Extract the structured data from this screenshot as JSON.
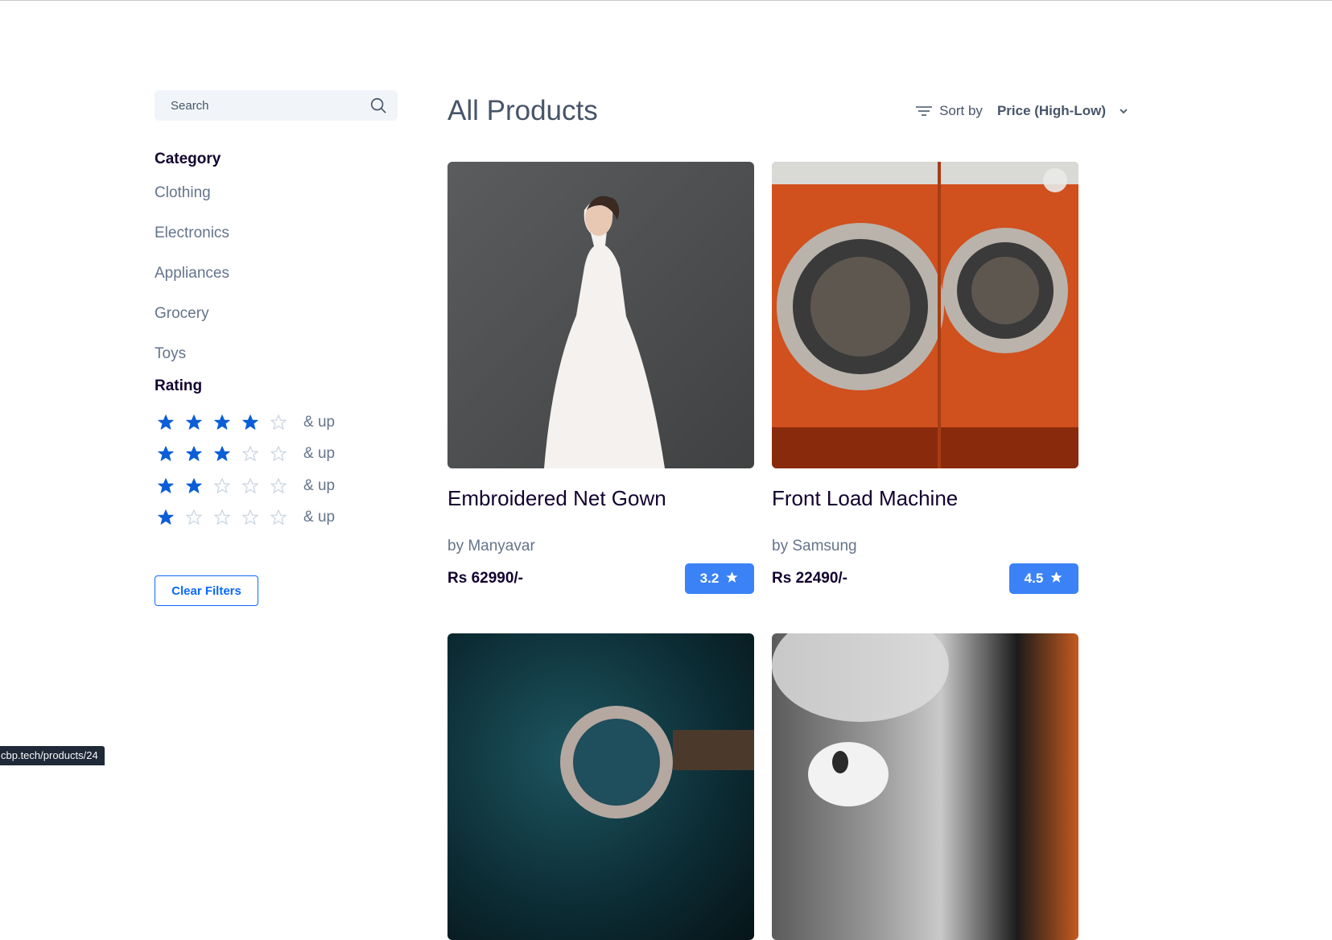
{
  "search": {
    "placeholder": "Search"
  },
  "filters": {
    "category_heading": "Category",
    "categories": [
      "Clothing",
      "Electronics",
      "Appliances",
      "Grocery",
      "Toys"
    ],
    "rating_heading": "Rating",
    "ratings": [
      {
        "stars": 4,
        "label": "& up"
      },
      {
        "stars": 3,
        "label": "& up"
      },
      {
        "stars": 2,
        "label": "& up"
      },
      {
        "stars": 1,
        "label": "& up"
      }
    ],
    "clear_label": "Clear Filters"
  },
  "main": {
    "title": "All Products",
    "sort_label": "Sort by",
    "sort_value": "Price (High-Low)"
  },
  "products": [
    {
      "title": "Embroidered Net Gown",
      "brand": "by Manyavar",
      "price": "Rs 62990/-",
      "rating": "3.2",
      "image": "gown-photo"
    },
    {
      "title": "Front Load Machine",
      "brand": "by Samsung",
      "price": "Rs 22490/-",
      "rating": "4.5",
      "image": "washing-machine-photo"
    },
    {
      "title": "",
      "brand": "",
      "price": "",
      "rating": "",
      "image": "watch-photo"
    },
    {
      "title": "",
      "brand": "",
      "price": "",
      "rating": "",
      "image": "earbuds-photo"
    }
  ],
  "status_bar": {
    "url": "cbp.tech/products/24"
  },
  "colors": {
    "accent": "#0b69ff",
    "badge": "#3b82f6",
    "heading": "#12022f",
    "muted": "#64748b"
  }
}
